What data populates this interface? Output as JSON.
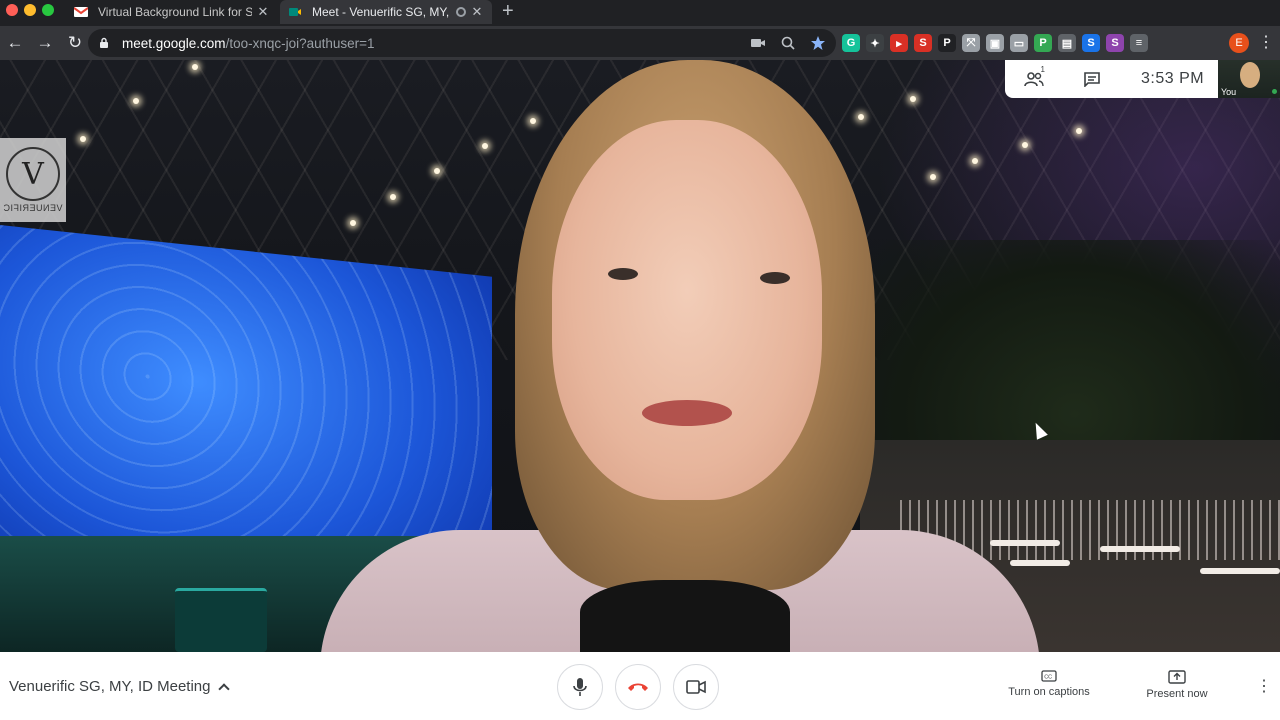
{
  "browser": {
    "tabs": [
      {
        "title": "Virtual Background Link for Sn",
        "icon": "gmail-icon",
        "active": false
      },
      {
        "title": "Meet - Venuerific SG, MY,",
        "icon": "meet-icon",
        "active": true
      }
    ],
    "new_tab": "+",
    "url_host": "meet.google.com",
    "url_path": "/too-xnqc-joi?authuser=1",
    "profile_initial": "E",
    "extensions": [
      {
        "name": "grammarly-icon",
        "label": "G",
        "color": "#15c39a"
      },
      {
        "name": "extension-icon-2",
        "label": "✦",
        "color": "#3c4043"
      },
      {
        "name": "extension-icon-3",
        "label": "▸",
        "color": "#d93025"
      },
      {
        "name": "extension-icon-4",
        "label": "S",
        "color": "#d93025"
      },
      {
        "name": "extension-icon-5",
        "label": "P",
        "color": "#202124"
      },
      {
        "name": "extension-icon-6",
        "label": "⤧",
        "color": "#9aa0a6"
      },
      {
        "name": "extension-icon-7",
        "label": "▣",
        "color": "#9aa0a6"
      },
      {
        "name": "extension-icon-8",
        "label": "▭",
        "color": "#9aa0a6"
      },
      {
        "name": "extension-icon-9",
        "label": "P",
        "color": "#34a853"
      },
      {
        "name": "extension-icon-10",
        "label": "▤",
        "color": "#5f6368"
      },
      {
        "name": "extension-icon-11",
        "label": "S",
        "color": "#1a73e8"
      },
      {
        "name": "extension-icon-12",
        "label": "S",
        "color": "#8e44ad"
      },
      {
        "name": "reading-list-icon",
        "label": "≡",
        "color": "#5f6368"
      }
    ]
  },
  "meet": {
    "participants_count": "1",
    "time": "3:53 PM",
    "self_label": "You",
    "meeting_title": "Venuerific SG, MY, ID Meeting",
    "captions_label": "Turn on captions",
    "present_label": "Present now",
    "logo_word": "VENUERIFIC",
    "logo_letter": "V"
  },
  "colors": {
    "accent_red": "#ea4335",
    "browser_bg": "#202124",
    "toolbar_bg": "#35363a"
  }
}
